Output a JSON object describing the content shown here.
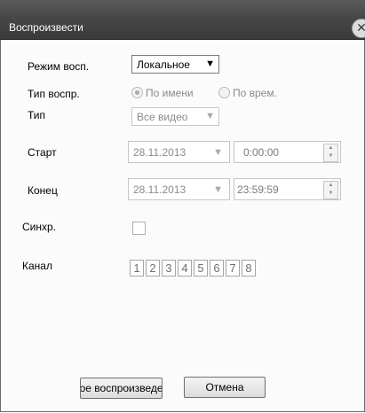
{
  "window": {
    "title": "Воспроизвести",
    "close_glyph": "✕"
  },
  "form": {
    "mode_label": "Режим восп.",
    "mode_value": "Локальное",
    "playback_type_label": "Тип воспр.",
    "playback_type_options": [
      {
        "label": "По имени",
        "selected": true
      },
      {
        "label": "По врем.",
        "selected": false
      }
    ],
    "type_label": "Тип",
    "type_value": "Все видео",
    "start_label": "Старт",
    "start_date": "28.11.2013",
    "start_time": "0:00:00",
    "end_label": "Конец",
    "end_date": "28.11.2013",
    "end_time": "23:59:59",
    "sync_label": "Синхр.",
    "sync_checked": false,
    "channel_label": "Канал",
    "channels": [
      "1",
      "2",
      "3",
      "4",
      "5",
      "6",
      "7",
      "8"
    ]
  },
  "buttons": {
    "playback_label": "Локальное воспроизведение",
    "cancel_label": "Отмена"
  }
}
